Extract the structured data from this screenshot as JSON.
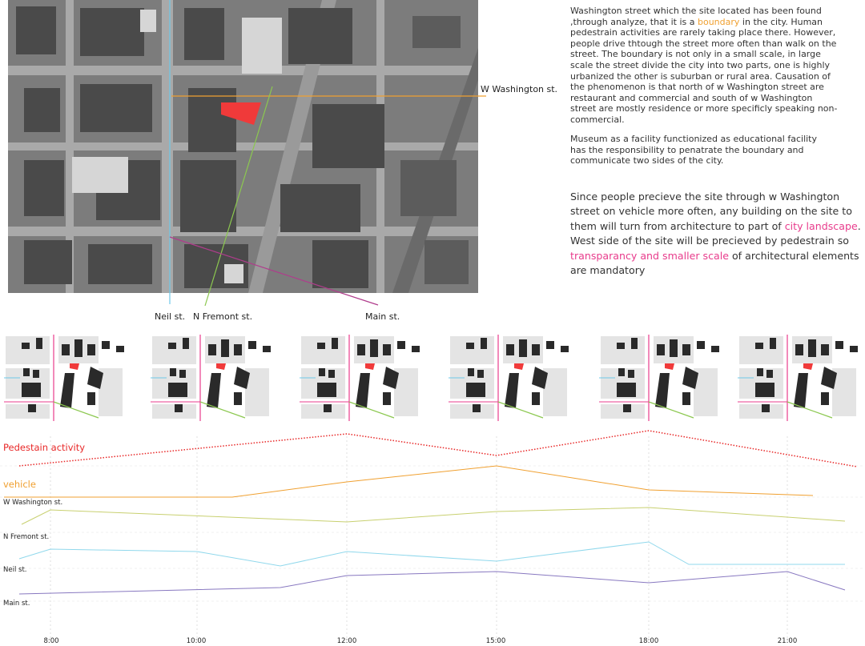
{
  "streets": {
    "washington": "W Washington st.",
    "neil": "Neil st.",
    "fremont": "N Fremont st.",
    "main": "Main st."
  },
  "text": {
    "p1_before": "Washington street which the site located has been found ,through analyze, that it is a ",
    "p1_highlight": "boundary",
    "p1_after": " in the city. Human pedestrain activities are rarely taking place there. However, people drive thtough the street more often than walk on the street. The boundary is not only in a small scale, in large scale the street divide the city into two parts, one is highly urbanized the other is suburban or rural area. Causation of the phenomenon is that north of w Washington street are restaurant and commercial and south of w Washington street are mostly residence or more specificly speaking non-commercial.",
    "p2": "Museum as a facility functionized as educational facility has the responsibility to penatrate the boundary and communicate two sides of the city.",
    "p3_a": "Since people precieve the site through w Washington street on vehicle more often, any building on the site to them will turn from architecture to part of ",
    "p3_hl1": "city landscape",
    "p3_b": ". West side of the site will be precieved by pedestrain so ",
    "p3_hl2": "transparancy and smaller scale",
    "p3_c": " of architectural elements are mandatory"
  },
  "timeline": {
    "pedestrian_label": "Pedestain activity",
    "vehicle_label": "vehicle",
    "row_labels": [
      "W Washington st.",
      "N Fremont st.",
      "Neil st.",
      "Main st."
    ],
    "times": [
      "8:00",
      "10:00",
      "12:00",
      "15:00",
      "18:00",
      "21:00"
    ]
  },
  "colors": {
    "site": "#f03a3a",
    "washington_line": "#f0a030",
    "neil_line": "#6ec8e8",
    "fremont_line": "#8cc850",
    "main_line": "#b03c8c",
    "pedestrian": "#e82828",
    "vehicle": "#f0a030",
    "washington_graph": "#c8d070",
    "fremont_graph": "#90d8ec",
    "neil_graph": "#8878c0"
  }
}
